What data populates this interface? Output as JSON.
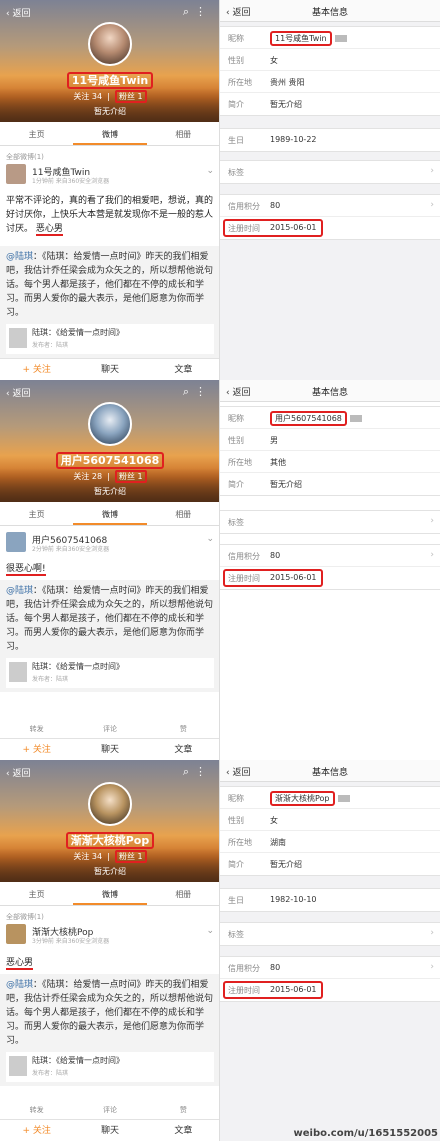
{
  "panels": [
    {
      "profile": {
        "back": "返回",
        "nickname": "11号咸鱼Twin",
        "following_label": "关注",
        "following_count": "34",
        "fans_label": "粉丝",
        "fans_count": "1",
        "intro": "暂无介绍",
        "tabs": [
          "主页",
          "微博",
          "相册"
        ],
        "feed_meta": "全部微博(1)",
        "post_author": "11号咸鱼Twin",
        "post_time": "1分钟前 来自360安全浏览器",
        "post_text_a": "平常不评论的，真的看了我们的相爱吧，想说，真的好讨厌你，上快乐大本营是就发现你不是一般的惹人讨厌。",
        "post_text_hl": "恶心男",
        "quote_link": "@陆琪",
        "quote_text": "：《陆琪：给爱情一点时间》昨天的我们相爱吧，我估计乔任梁会成为众矢之的，所以想帮他说句话。每个男人都是孩子，他们都在不停的成长和学习。而男人爱你的最大表示，是他们愿意为你而学习。",
        "card_title": "陆琪：《给爱情一点时间》",
        "card_sub": "发布者：陆琪",
        "bar": [
          "+ 关注",
          "聊天",
          "文章"
        ]
      },
      "info": {
        "back": "返回",
        "title": "基本信息",
        "rows": [
          {
            "k": "昵称",
            "v": "11号咸鱼Twin"
          },
          {
            "k": "性别",
            "v": "女"
          },
          {
            "k": "所在地",
            "v": "贵州 贵阳"
          },
          {
            "k": "简介",
            "v": "暂无介绍"
          }
        ],
        "birthday_k": "生日",
        "birthday_v": "1989-10-22",
        "tag_k": "标签",
        "credit_k": "信用积分",
        "credit_v": "80",
        "reg_k": "注册时间",
        "reg_v": "2015-06-01"
      }
    },
    {
      "profile": {
        "back": "返回",
        "nickname": "用户5607541068",
        "following_label": "关注",
        "following_count": "28",
        "fans_label": "粉丝",
        "fans_count": "1",
        "intro": "暂无介绍",
        "tabs": [
          "主页",
          "微博",
          "相册"
        ],
        "post_author": "用户5607541068",
        "post_time": "2分钟前 来自360安全浏览器",
        "post_text_hl": "很恶心啊!",
        "quote_link": "@陆琪",
        "quote_text": "：《陆琪：给爱情一点时间》昨天的我们相爱吧，我估计乔任梁会成为众矢之的，所以想帮他说句话。每个男人都是孩子，他们都在不停的成长和学习。而男人爱你的最大表示，是他们愿意为你而学习。",
        "card_title": "陆琪：《给爱情一点时间》",
        "card_sub": "发布者：陆琪",
        "actions": [
          "转发",
          "评论",
          "赞"
        ],
        "bar": [
          "+ 关注",
          "聊天",
          "文章"
        ]
      },
      "info": {
        "back": "返回",
        "title": "基本信息",
        "rows": [
          {
            "k": "昵称",
            "v": "用户5607541068"
          },
          {
            "k": "性别",
            "v": "男"
          },
          {
            "k": "所在地",
            "v": "其他"
          },
          {
            "k": "简介",
            "v": "暂无介绍"
          }
        ],
        "tag_k": "标签",
        "credit_k": "信用积分",
        "credit_v": "80",
        "reg_k": "注册时间",
        "reg_v": "2015-06-01"
      }
    },
    {
      "profile": {
        "back": "返回",
        "nickname": "渐渐大核桃Pop",
        "following_label": "关注",
        "following_count": "34",
        "fans_label": "粉丝",
        "fans_count": "1",
        "intro": "暂无介绍",
        "tabs": [
          "主页",
          "微博",
          "相册"
        ],
        "feed_meta": "全部微博(1)",
        "post_author": "渐渐大核桃Pop",
        "post_time": "3分钟前 来自360安全浏览器",
        "post_text_hl": "恶心男",
        "quote_link": "@陆琪",
        "quote_text": "：《陆琪：给爱情一点时间》昨天的我们相爱吧，我估计乔任梁会成为众矢之的，所以想帮他说句话。每个男人都是孩子，他们都在不停的成长和学习。而男人爱你的最大表示，是他们愿意为你而学习。",
        "card_title": "陆琪：《给爱情一点时间》",
        "card_sub": "发布者：陆琪",
        "actions": [
          "转发",
          "评论",
          "赞"
        ],
        "bar": [
          "+ 关注",
          "聊天",
          "文章"
        ]
      },
      "info": {
        "back": "返回",
        "title": "基本信息",
        "rows": [
          {
            "k": "昵称",
            "v": "渐渐大核桃Pop"
          },
          {
            "k": "性别",
            "v": "女"
          },
          {
            "k": "所在地",
            "v": "湖南"
          },
          {
            "k": "简介",
            "v": "暂无介绍"
          }
        ],
        "birthday_k": "生日",
        "birthday_v": "1982-10-10",
        "tag_k": "标签",
        "credit_k": "信用积分",
        "credit_v": "80",
        "reg_k": "注册时间",
        "reg_v": "2015-06-01"
      }
    }
  ],
  "watermark": "weibo.com/u/1651552005"
}
